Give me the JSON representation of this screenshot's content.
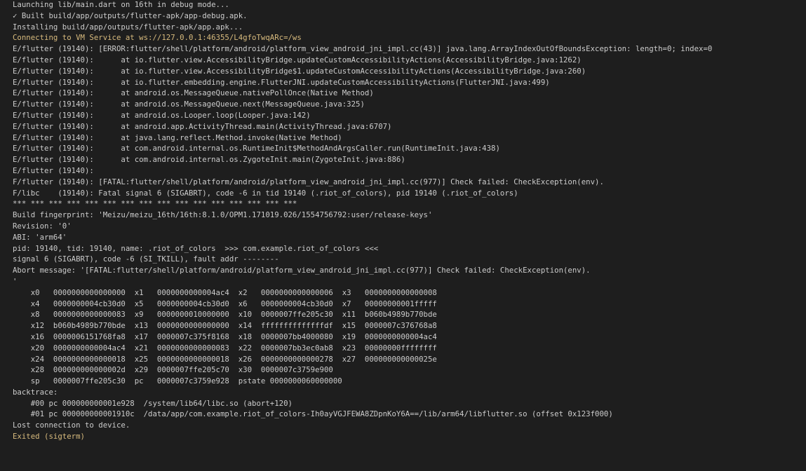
{
  "colors": {
    "background": "#1e1e1e",
    "text": "#cccccc",
    "highlight": "#d7ba7d"
  },
  "lines": [
    {
      "text": "Launching lib/main.dart on 16th in debug mode...",
      "style": "normal"
    },
    {
      "text": "✓ Built build/app/outputs/flutter-apk/app-debug.apk.",
      "style": "normal"
    },
    {
      "text": "Installing build/app/outputs/flutter-apk/app.apk...",
      "style": "normal"
    },
    {
      "text": "Connecting to VM Service at ws://127.0.0.1:46355/L4gfoTwqARc=/ws",
      "style": "warn"
    },
    {
      "text": "E/flutter (19140): [ERROR:flutter/shell/platform/android/platform_view_android_jni_impl.cc(43)] java.lang.ArrayIndexOutOfBoundsException: length=0; index=0",
      "style": "normal"
    },
    {
      "text": "E/flutter (19140):      at io.flutter.view.AccessibilityBridge.updateCustomAccessibilityActions(AccessibilityBridge.java:1262)",
      "style": "normal"
    },
    {
      "text": "E/flutter (19140):      at io.flutter.view.AccessibilityBridge$1.updateCustomAccessibilityActions(AccessibilityBridge.java:260)",
      "style": "normal"
    },
    {
      "text": "E/flutter (19140):      at io.flutter.embedding.engine.FlutterJNI.updateCustomAccessibilityActions(FlutterJNI.java:499)",
      "style": "normal"
    },
    {
      "text": "E/flutter (19140):      at android.os.MessageQueue.nativePollOnce(Native Method)",
      "style": "normal"
    },
    {
      "text": "E/flutter (19140):      at android.os.MessageQueue.next(MessageQueue.java:325)",
      "style": "normal"
    },
    {
      "text": "E/flutter (19140):      at android.os.Looper.loop(Looper.java:142)",
      "style": "normal"
    },
    {
      "text": "E/flutter (19140):      at android.app.ActivityThread.main(ActivityThread.java:6707)",
      "style": "normal"
    },
    {
      "text": "E/flutter (19140):      at java.lang.reflect.Method.invoke(Native Method)",
      "style": "normal"
    },
    {
      "text": "E/flutter (19140):      at com.android.internal.os.RuntimeInit$MethodAndArgsCaller.run(RuntimeInit.java:438)",
      "style": "normal"
    },
    {
      "text": "E/flutter (19140):      at com.android.internal.os.ZygoteInit.main(ZygoteInit.java:886)",
      "style": "normal"
    },
    {
      "text": "E/flutter (19140):",
      "style": "normal"
    },
    {
      "text": "F/flutter (19140): [FATAL:flutter/shell/platform/android/platform_view_android_jni_impl.cc(977)] Check failed: CheckException(env).",
      "style": "normal"
    },
    {
      "text": "F/libc    (19140): Fatal signal 6 (SIGABRT), code -6 in tid 19140 (.riot_of_colors), pid 19140 (.riot_of_colors)",
      "style": "normal"
    },
    {
      "text": "*** *** *** *** *** *** *** *** *** *** *** *** *** *** *** ***",
      "style": "normal"
    },
    {
      "text": "Build fingerprint: 'Meizu/meizu_16th/16th:8.1.0/OPM1.171019.026/1554756792:user/release-keys'",
      "style": "normal"
    },
    {
      "text": "Revision: '0'",
      "style": "normal"
    },
    {
      "text": "ABI: 'arm64'",
      "style": "normal"
    },
    {
      "text": "pid: 19140, tid: 19140, name: .riot_of_colors  >>> com.example.riot_of_colors <<<",
      "style": "normal"
    },
    {
      "text": "signal 6 (SIGABRT), code -6 (SI_TKILL), fault addr --------",
      "style": "normal"
    },
    {
      "text": "Abort message: '[FATAL:flutter/shell/platform/android/platform_view_android_jni_impl.cc(977)] Check failed: CheckException(env).",
      "style": "normal"
    },
    {
      "text": "'",
      "style": "normal"
    },
    {
      "text": "    x0   0000000000000000  x1   0000000000004ac4  x2   0000000000000006  x3   0000000000000008",
      "style": "normal"
    },
    {
      "text": "    x4   0000000004cb30d0  x5   0000000004cb30d0  x6   0000000004cb30d0  x7   00000000001fffff",
      "style": "normal"
    },
    {
      "text": "    x8   0000000000000083  x9   0000000010000000  x10  0000007ffe205c30  x11  b060b4989b770bde",
      "style": "normal"
    },
    {
      "text": "    x12  b060b4989b770bde  x13  0000000000000000  x14  ffffffffffffffdf  x15  0000007c376768a8",
      "style": "normal"
    },
    {
      "text": "    x16  0000006151768fa8  x17  0000007c375f8168  x18  0000007bb4000080  x19  0000000000004ac4",
      "style": "normal"
    },
    {
      "text": "    x20  0000000000004ac4  x21  0000000000000083  x22  0000007bb3ec0ab8  x23  00000000ffffffff",
      "style": "normal"
    },
    {
      "text": "    x24  0000000000000018  x25  0000000000000018  x26  0000000000000278  x27  000000000000025e",
      "style": "normal"
    },
    {
      "text": "    x28  000000000000002d  x29  0000007ffe205c70  x30  0000007c3759e900",
      "style": "normal"
    },
    {
      "text": "    sp   0000007ffe205c30  pc   0000007c3759e928  pstate 0000000060000000",
      "style": "normal"
    },
    {
      "text": "backtrace:",
      "style": "normal"
    },
    {
      "text": "    #00 pc 000000000001e928  /system/lib64/libc.so (abort+120)",
      "style": "normal"
    },
    {
      "text": "    #01 pc 000000000001910c  /data/app/com.example.riot_of_colors-Ih0ayVGJFEWA8ZDpnKoY6A==/lib/arm64/libflutter.so (offset 0x123f000)",
      "style": "normal"
    },
    {
      "text": "Lost connection to device.",
      "style": "normal"
    },
    {
      "text": "Exited (sigterm)",
      "style": "warn"
    }
  ]
}
